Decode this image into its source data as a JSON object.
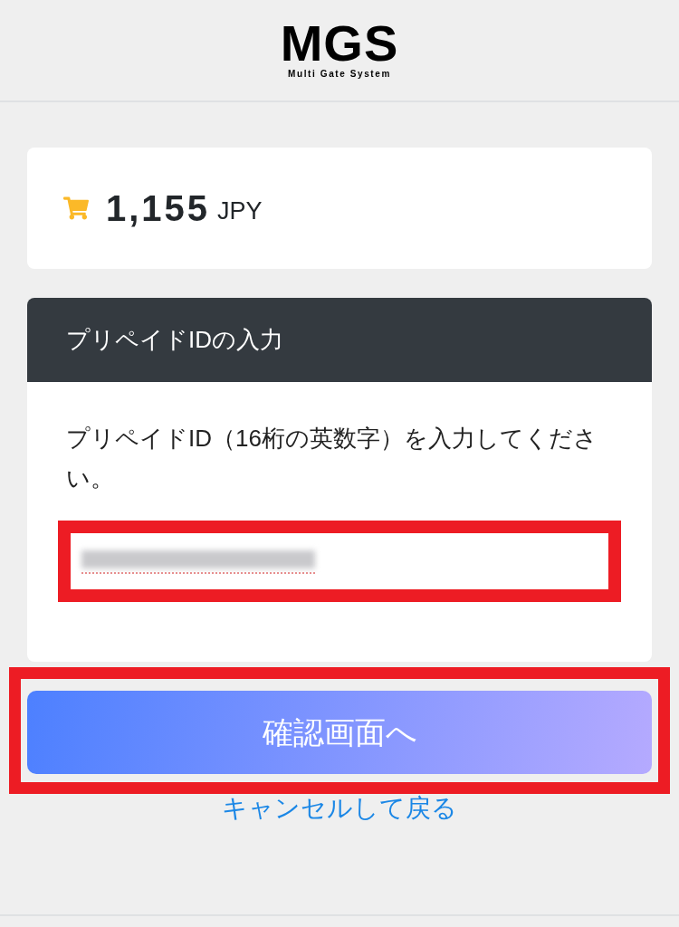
{
  "header": {
    "logo": "MGS",
    "tagline": "Multi Gate System"
  },
  "summary": {
    "amount": "1,155",
    "currency": "JPY"
  },
  "prepaid_panel": {
    "title": "プリペイドIDの入力",
    "instruction": "プリペイドID（16桁の英数字）を入力してください。",
    "input": {
      "value_blurred": true,
      "highlighted": true
    }
  },
  "confirm_button": {
    "label": "確認画面へ",
    "highlighted": true
  },
  "cancel_link": {
    "label": "キャンセルして戻る"
  }
}
